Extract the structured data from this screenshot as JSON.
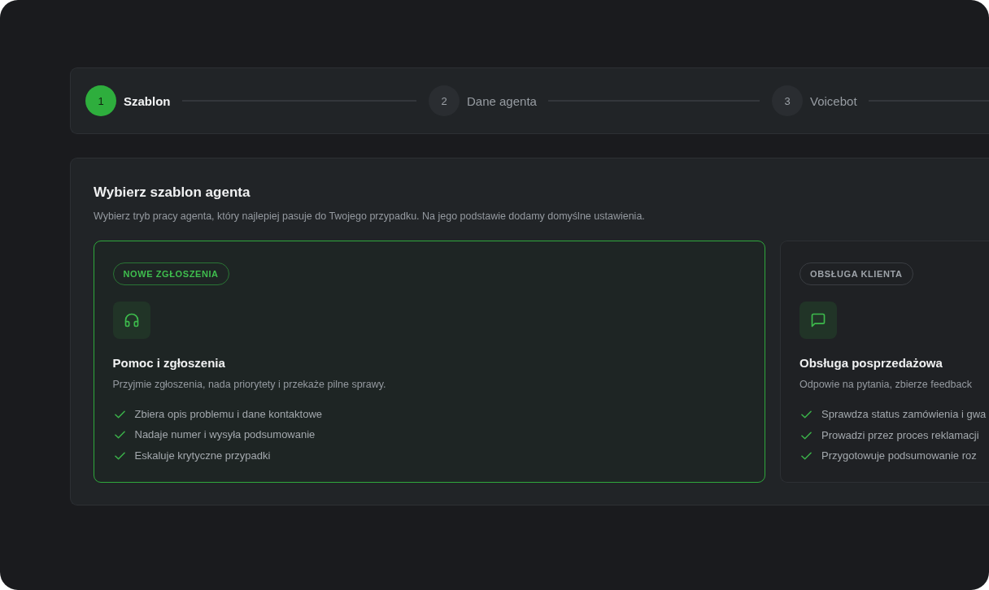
{
  "stepper": {
    "steps": [
      {
        "number": "1",
        "label": "Szablon",
        "selected": true
      },
      {
        "number": "2",
        "label": "Dane agenta",
        "selected": false
      },
      {
        "number": "3",
        "label": "Voicebot",
        "selected": false
      }
    ]
  },
  "template_picker": {
    "title": "Wybierz szablon agenta",
    "subtitle": "Wybierz tryb pracy agenta, który najlepiej pasuje do Twojego przypadku. Na jego podstawie dodamy domyślne ustawienia.",
    "cards": [
      {
        "tag": "NOWE ZGŁOSZENIA",
        "title": "Pomoc i zgłoszenia",
        "description": "Przyjmie zgłoszenia, nada priorytety i przekaże pilne sprawy.",
        "features": [
          "Zbiera opis problemu i dane kontaktowe",
          "Nadaje numer i wysyła podsumowanie",
          "Eskaluje krytyczne przypadki"
        ],
        "selected": true
      },
      {
        "tag": "OBSŁUGA KLIENTA",
        "title": "Obsługa posprzedażowa",
        "description": "Odpowie na pytania, zbierze feedback",
        "features": [
          "Sprawdza status zamówienia i gwa",
          "Prowadzi przez proces reklamacji",
          "Przygotowuje podsumowanie roz"
        ],
        "selected": false
      }
    ]
  }
}
